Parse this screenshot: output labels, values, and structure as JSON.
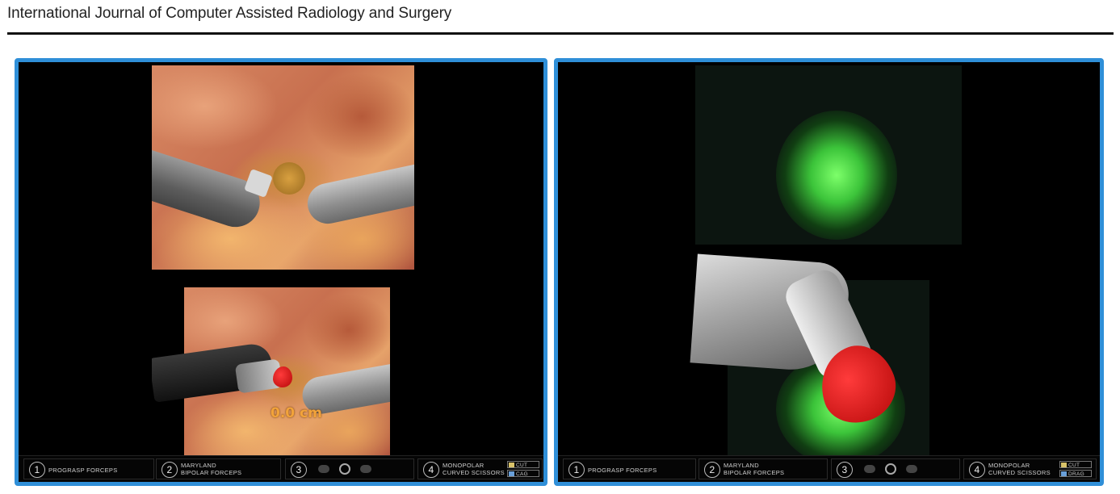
{
  "journal": {
    "title": "International Journal of Computer Assisted Radiology and Surgery"
  },
  "left_panel": {
    "distance_label": "0.0 cm",
    "status_bar": {
      "slot1": {
        "number": "1",
        "label": "PROGRASP FORCEPS"
      },
      "slot2": {
        "number": "2",
        "label": "MARYLAND BIPOLAR FORCEPS"
      },
      "slot3": {
        "number": "3"
      },
      "slot4": {
        "number": "4",
        "label": "MONOPOLAR CURVED SCISSORS",
        "energy_top": "CUT",
        "energy_bottom": "CAG"
      }
    }
  },
  "right_panel": {
    "status_bar": {
      "slot1": {
        "number": "1",
        "label": "PROGRASP FORCEPS"
      },
      "slot2": {
        "number": "2",
        "label": "MARYLAND BIPOLAR FORCEPS"
      },
      "slot3": {
        "number": "3"
      },
      "slot4": {
        "number": "4",
        "label": "MONOPOLAR CURVED SCISSORS",
        "energy_top": "CUT",
        "energy_bottom": "DRAG"
      }
    }
  },
  "colors": {
    "panel_border": "#2f8fd8",
    "overlay_red": "#e02020",
    "fluorescence_green": "#5ae04a",
    "distance_label": "#f2a33a"
  }
}
